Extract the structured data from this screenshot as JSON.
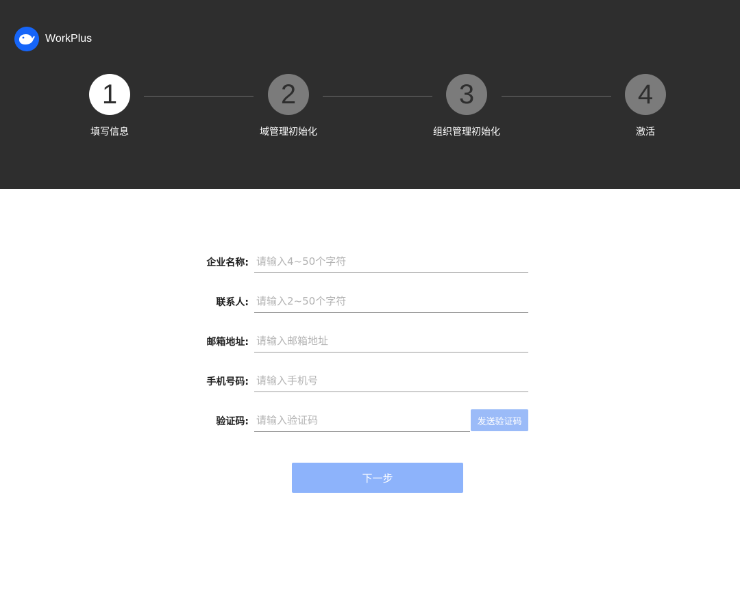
{
  "app": {
    "name": "WorkPlus"
  },
  "steps": [
    {
      "number": "1",
      "label": "填写信息",
      "active": true
    },
    {
      "number": "2",
      "label": "域管理初始化",
      "active": false
    },
    {
      "number": "3",
      "label": "组织管理初始化",
      "active": false
    },
    {
      "number": "4",
      "label": "激活",
      "active": false
    }
  ],
  "form": {
    "company": {
      "label": "企业名称:",
      "value": "",
      "placeholder": "请输入4~50个字符"
    },
    "contact": {
      "label": "联系人:",
      "value": "",
      "placeholder": "请输入2~50个字符"
    },
    "email": {
      "label": "邮箱地址:",
      "value": "",
      "placeholder": "请输入邮箱地址"
    },
    "phone": {
      "label": "手机号码:",
      "value": "",
      "placeholder": "请输入手机号"
    },
    "code": {
      "label": "验证码:",
      "value": "",
      "placeholder": "请输入验证码"
    },
    "send_code_label": "发送验证码",
    "next_label": "下一步"
  },
  "colors": {
    "header_bg": "#2e2e2e",
    "brand_blue": "#1665f8",
    "step_active": "#ffffff",
    "step_inactive": "#7b7b7b",
    "button_disabled": "#8db3fb"
  },
  "icons": {
    "logo": "whale-logo-icon"
  }
}
